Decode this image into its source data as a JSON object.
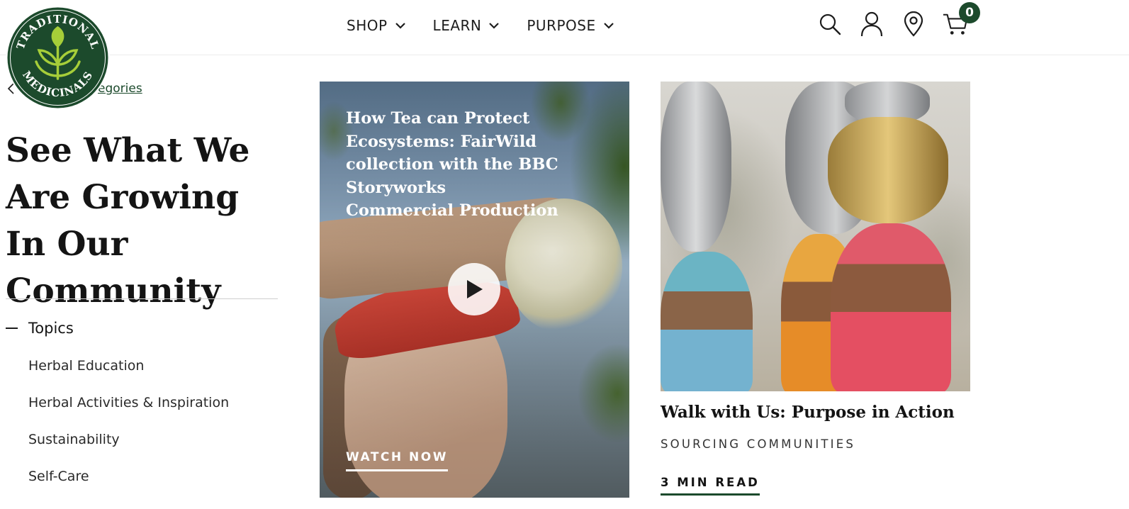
{
  "brand": {
    "logo_alt": "Traditional Medicinals",
    "logo_top_text": "TRADITIONAL",
    "logo_bottom_text": "MEDICINALS"
  },
  "nav": {
    "items": [
      {
        "label": "SHOP",
        "icon": "chevron-down-icon"
      },
      {
        "label": "LEARN",
        "icon": "chevron-down-icon"
      },
      {
        "label": "PURPOSE",
        "icon": "chevron-down-icon"
      }
    ]
  },
  "header_icons": {
    "search": "search-icon",
    "account": "user-icon",
    "store_locator": "location-pin-icon",
    "cart": "cart-icon",
    "cart_count": "0"
  },
  "sidebar": {
    "back_label": "All Categories",
    "back_visible_label": "egories",
    "title": "See What We Are Growing In Our Community",
    "topics_label": "Topics",
    "topics": [
      "Herbal Education",
      "Herbal Activities & Inspiration",
      "Sustainability",
      "Self-Care"
    ]
  },
  "cards": [
    {
      "title": "How Tea can Protect Ecosystems: FairWild collection with the BBC Storyworks Commercial Production",
      "cta": "WATCH NOW",
      "type": "video"
    },
    {
      "title": "Walk with Us: Purpose in Action",
      "category": "SOURCING COMMUNITIES",
      "cta": "3 MIN READ",
      "type": "article"
    }
  ],
  "colors": {
    "brand_green": "#1c4a2c",
    "logo_leaf": "#a6ce39",
    "text": "#141414"
  }
}
